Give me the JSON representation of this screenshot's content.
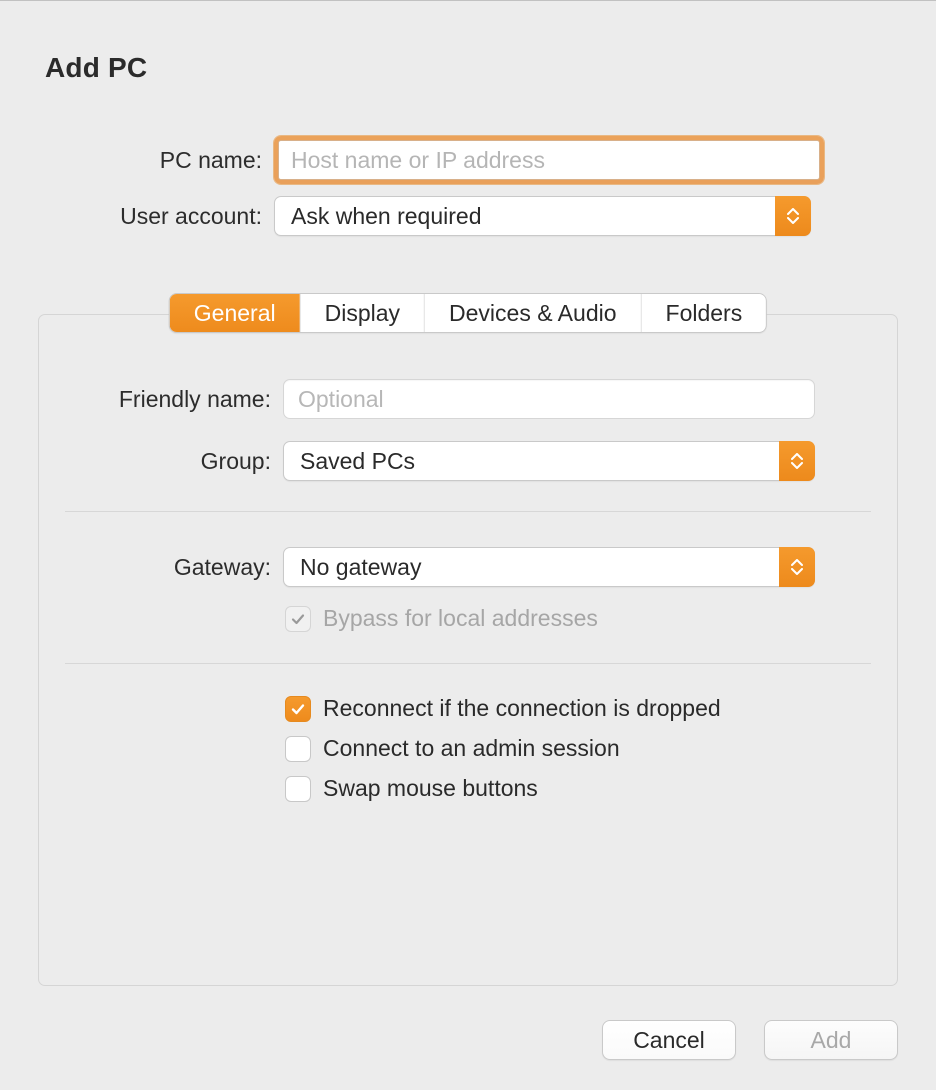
{
  "title": "Add PC",
  "fields": {
    "pc_name_label": "PC name:",
    "pc_name_placeholder": "Host name or IP address",
    "pc_name_value": "",
    "user_account_label": "User account:",
    "user_account_value": "Ask when required"
  },
  "tabs": {
    "general": "General",
    "display": "Display",
    "devices_audio": "Devices & Audio",
    "folders": "Folders",
    "active": "general"
  },
  "general": {
    "friendly_label": "Friendly name:",
    "friendly_placeholder": "Optional",
    "friendly_value": "",
    "group_label": "Group:",
    "group_value": "Saved PCs",
    "gateway_label": "Gateway:",
    "gateway_value": "No gateway",
    "bypass_label": "Bypass for local addresses",
    "bypass_checked": true,
    "bypass_enabled": false,
    "reconnect_label": "Reconnect if the connection is dropped",
    "reconnect_checked": true,
    "admin_label": "Connect to an admin session",
    "admin_checked": false,
    "swap_label": "Swap mouse buttons",
    "swap_checked": false
  },
  "footer": {
    "cancel": "Cancel",
    "add": "Add",
    "add_enabled": false
  },
  "colors": {
    "accent": "#f18f22"
  }
}
